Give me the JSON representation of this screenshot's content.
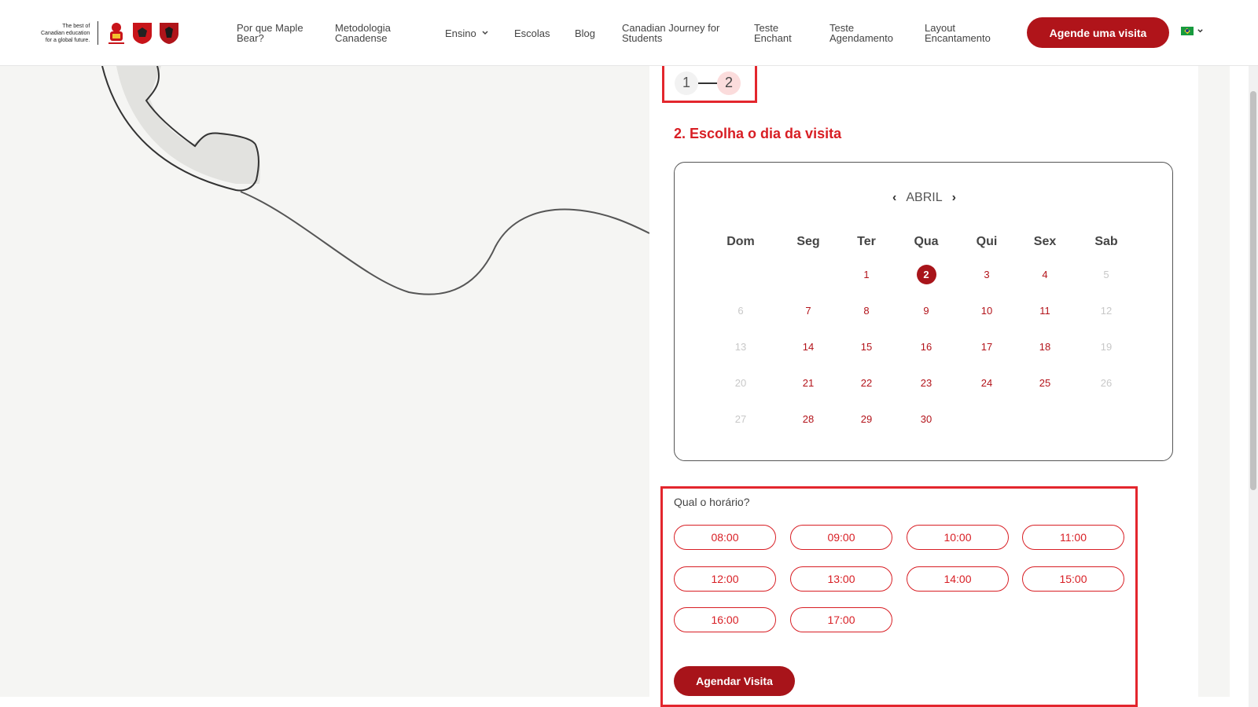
{
  "header": {
    "logo_tagline": [
      "The best of",
      "Canadian education",
      "for a global future."
    ],
    "nav": [
      "Por que Maple Bear?",
      "Metodologia Canadense",
      "Ensino",
      "Escolas",
      "Blog",
      "Canadian Journey for Students",
      "Teste Enchant",
      "Teste Agendamento",
      "Layout Encantamento"
    ],
    "cta_label": "Agende uma visita",
    "language_icon": "brazil-flag-icon"
  },
  "steps": {
    "step1": "1",
    "step2": "2",
    "current": 2
  },
  "section_title": "2. Escolha o dia da visita",
  "calendar": {
    "month": "ABRIL",
    "weekdays": [
      "Dom",
      "Seg",
      "Ter",
      "Qua",
      "Qui",
      "Sex",
      "Sab"
    ],
    "selected_day": "2",
    "weeks": [
      [
        "",
        "",
        "1",
        "2",
        "3",
        "4",
        "5"
      ],
      [
        "6",
        "7",
        "8",
        "9",
        "10",
        "11",
        "12"
      ],
      [
        "13",
        "14",
        "15",
        "16",
        "17",
        "18",
        "19"
      ],
      [
        "20",
        "21",
        "22",
        "23",
        "24",
        "25",
        "26"
      ],
      [
        "27",
        "28",
        "29",
        "30",
        "",
        "",
        ""
      ]
    ]
  },
  "time": {
    "question": "Qual o horário?",
    "slots": [
      "08:00",
      "09:00",
      "10:00",
      "11:00",
      "12:00",
      "13:00",
      "14:00",
      "15:00",
      "16:00",
      "17:00"
    ]
  },
  "submit_label": "Agendar Visita",
  "colors": {
    "brand_red": "#b0141a",
    "accent_red": "#d81e24",
    "highlight_border": "#e3262d",
    "disabled_day": "#c8c8c8"
  }
}
